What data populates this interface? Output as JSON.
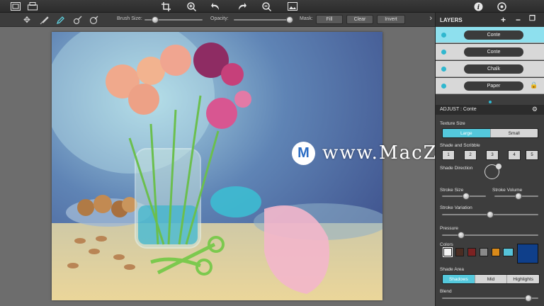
{
  "toolbar": {
    "icons": [
      "image-icon",
      "print-icon",
      "crop-icon",
      "zoom-in-icon",
      "undo-icon",
      "redo-icon",
      "zoom-out-icon",
      "fit-screen-icon",
      "info-icon",
      "settings-icon"
    ]
  },
  "options": {
    "brush_size_label": "Brush Size:",
    "brush_size": 0.18,
    "opacity_label": "Opacity:",
    "opacity": 0.96,
    "mask_label": "Mask:",
    "fill_label": "Fill",
    "clear_label": "Clear",
    "invert_label": "Invert"
  },
  "layers": {
    "title": "LAYERS",
    "items": [
      {
        "name": "Conte",
        "selected": true,
        "locked": false
      },
      {
        "name": "Conte",
        "selected": false,
        "locked": false
      },
      {
        "name": "Chalk",
        "selected": false,
        "locked": false
      },
      {
        "name": "Paper",
        "selected": false,
        "locked": true
      }
    ]
  },
  "adjust": {
    "title": "ADJUST : Conte",
    "texture_size_label": "Texture Size",
    "texture_options": [
      "Large",
      "Small"
    ],
    "texture_selected": "Large",
    "shade_scribble_label": "Shade and Scribble",
    "shade_values": [
      "1",
      "2",
      "3",
      "4",
      "5"
    ],
    "shade_direction_label": "Shade Direction",
    "stroke_size_label": "Stroke Size",
    "stroke_size": 0.55,
    "stroke_volume_label": "Stroke Volume",
    "stroke_volume": 0.55,
    "stroke_variation_label": "Stroke Variation",
    "stroke_variation": 0.5,
    "pressure_label": "Pressure",
    "pressure": 0.2,
    "colors_label": "Colors",
    "colors": [
      "#f4f4f4",
      "#4a2c22",
      "#7c2222",
      "#8a8a8a",
      "#d98a1a",
      "#56c3d9"
    ],
    "current_color": "#0f3f8a",
    "shade_area_label": "Shade Area",
    "shade_area_options": [
      "Shadows",
      "Mid",
      "Highlights"
    ],
    "shade_area_selected": "Shadows",
    "blend_label": "Blend",
    "blend": 0.9
  },
  "watermark": {
    "text": "www.MacZ.com"
  }
}
